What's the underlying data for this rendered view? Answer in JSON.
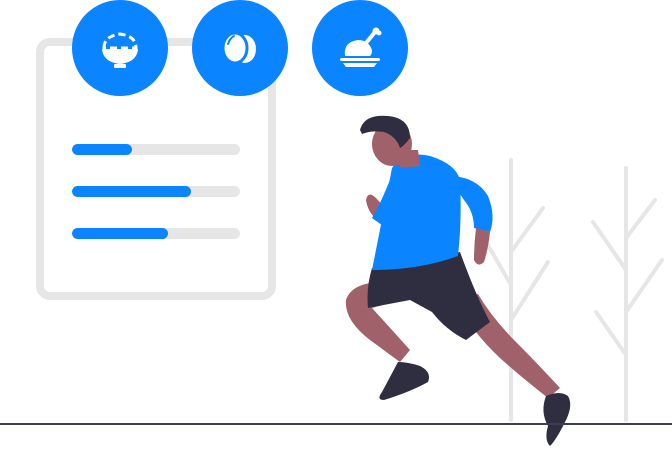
{
  "colors": {
    "accent": "#0a84ff",
    "track": "#e6e6e6",
    "ground": "#3f3d56",
    "skin": "#a0616a",
    "hair": "#2f2e41",
    "shorts": "#2f2e41",
    "plant": "#e6e6e6"
  },
  "food_icons": [
    "rice-bowl-icon",
    "eggs-icon",
    "roast-chicken-icon"
  ],
  "progress": [
    0.36,
    0.71,
    0.57
  ]
}
